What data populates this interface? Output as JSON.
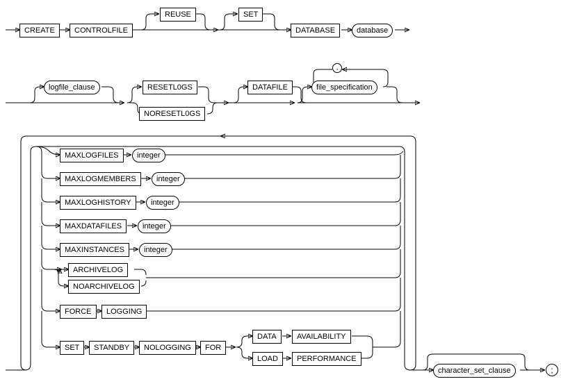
{
  "row1": {
    "create": "CREATE",
    "controlfile": "CONTROLFILE",
    "reuse": "REUSE",
    "set": "SET",
    "database": "DATABASE",
    "db_term": "database"
  },
  "row2": {
    "logfile_clause": "logfile_clause",
    "resetlogs": "RESETL0GS",
    "noresetlogs": "NORESETL0GS",
    "datafile": "DATAFILE",
    "file_spec": "file_specification",
    "comma": ","
  },
  "opts": {
    "maxlogfiles": "MAXLOGFILES",
    "maxlogmembers": "MAXLOGMEMBERS",
    "maxloghistory": "MAXLOGHISTORY",
    "maxdatafiles": "MAXDATAFILES",
    "maxinstances": "MAXINSTANCES",
    "integer": "integer",
    "archivelog": "ARCHIVELOG",
    "noarchivelog": "NOARCHIVELOG",
    "force": "FORCE",
    "logging": "LOGGING",
    "set": "SET",
    "standby": "STANDBY",
    "nologging": "NOLOGGING",
    "for": "FOR",
    "data": "DATA",
    "availability": "AVAILABILITY",
    "load": "LOAD",
    "performance": "PERFORMANCE"
  },
  "tail": {
    "charset": "character_set_clause",
    "semi": ";"
  }
}
